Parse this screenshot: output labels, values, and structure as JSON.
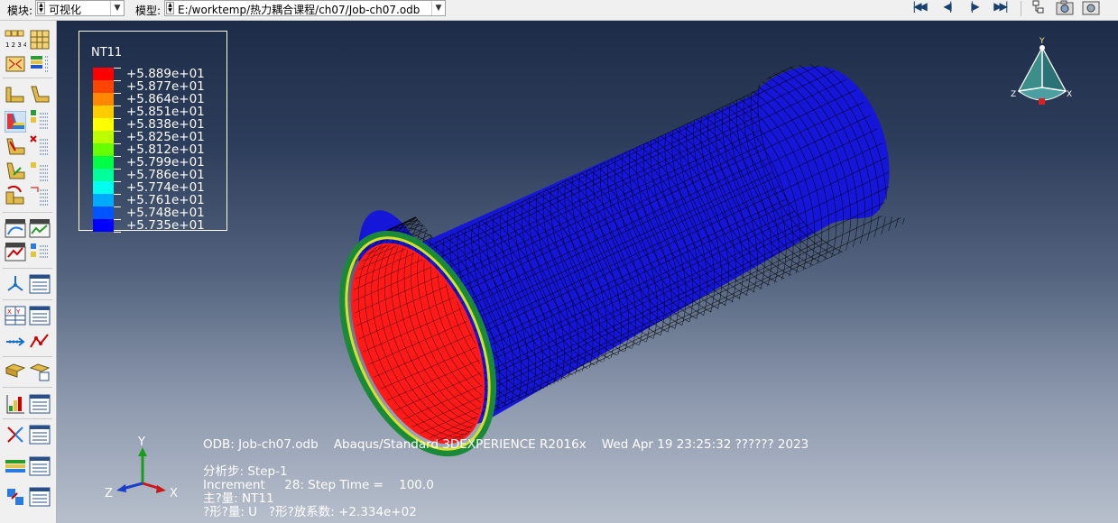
{
  "toolbar": {
    "module_label": "模块:",
    "module_value": "可视化",
    "model_label": "模型:",
    "model_value": "E:/worktemp/热力耦合课程/ch07/Job-ch07.odb"
  },
  "legend": {
    "variable": "NT11",
    "values": [
      "+5.889e+01",
      "+5.877e+01",
      "+5.864e+01",
      "+5.851e+01",
      "+5.838e+01",
      "+5.825e+01",
      "+5.812e+01",
      "+5.799e+01",
      "+5.786e+01",
      "+5.774e+01",
      "+5.761e+01",
      "+5.748e+01",
      "+5.735e+01"
    ],
    "colors": [
      "#ff0000",
      "#ff4400",
      "#ff8800",
      "#ffcc00",
      "#ffff00",
      "#bbff00",
      "#66ff00",
      "#00ff44",
      "#00ff99",
      "#00ffee",
      "#00aaff",
      "#0055ff",
      "#0000ff"
    ]
  },
  "triad_large": {
    "x": "X",
    "y": "Y",
    "z": "Z"
  },
  "triad_small": {
    "x": "X",
    "y": "Y",
    "z": "Z"
  },
  "info": {
    "line1": "ODB: Job-ch07.odb    Abaqus/Standard 3DEXPERIENCE R2016x    Wed Apr 19 23:25:32 ?????? 2023",
    "line2": "分析步: Step-1",
    "line3": "Increment     28: Step Time =    100.0",
    "line4": "主?量: NT11",
    "line5": "?形?量: U   ?形?放系数: +2.334e+02"
  },
  "colors": {
    "pipe_outer": "#1616d8",
    "pipe_inner": "#ff1a1a",
    "mesh_line": "#000000",
    "viewport_top": "#1d2c48",
    "viewport_bottom": "#b7bfcc"
  },
  "icons": {
    "nav": [
      "first-frame-icon",
      "previous-frame-icon",
      "next-frame-icon",
      "last-frame-icon"
    ],
    "right": [
      "tree-icon",
      "camera-icon",
      "capture-icon"
    ]
  }
}
